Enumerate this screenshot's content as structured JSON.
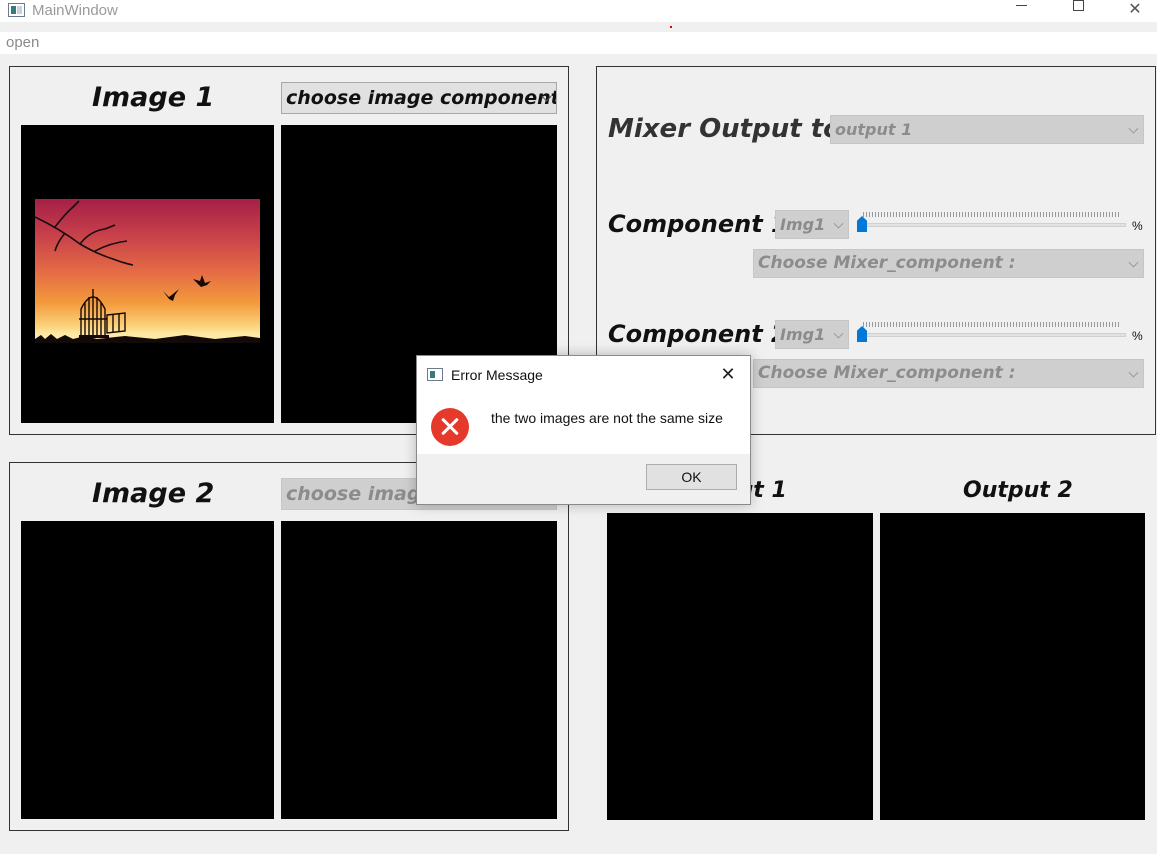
{
  "window": {
    "title": "MainWindow"
  },
  "menu": {
    "open": "open"
  },
  "image1": {
    "title": "Image 1",
    "component_combo": "choose image component:"
  },
  "image2": {
    "title": "Image 2",
    "component_combo": "choose image component:"
  },
  "mixer": {
    "output_label": "Mixer Output to :",
    "output_value": "output 1",
    "component1": {
      "label": "Component 1 :",
      "image_value": "Img1",
      "mix_combo": "Choose Mixer_component :",
      "percent_unit": "%",
      "slider_value": 0
    },
    "component2": {
      "label": "Component 2 :",
      "image_value": "Img1",
      "mix_combo": "Choose Mixer_component :",
      "percent_unit": "%",
      "slider_value": 0
    }
  },
  "outputs": {
    "output1_title": "Output 1",
    "output2_title": "Output 2"
  },
  "dialog": {
    "title": "Error Message",
    "message": "the two images are not the same size",
    "ok_label": "OK"
  },
  "colors": {
    "accent": "#0078d7",
    "error": "#e53a2b"
  }
}
